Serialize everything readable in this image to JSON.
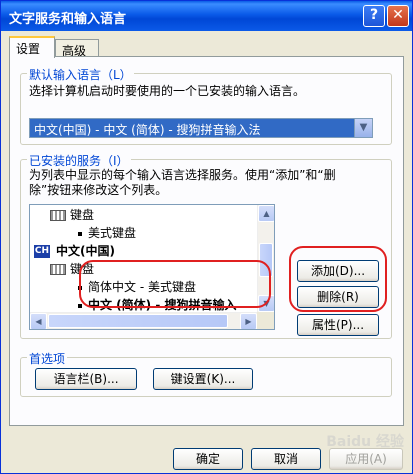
{
  "window": {
    "title": "文字服务和输入语言",
    "help_glyph": "?",
    "close_glyph": "✕"
  },
  "tabs": [
    {
      "label": "设置",
      "active": true
    },
    {
      "label": "高级",
      "active": false
    }
  ],
  "default_language": {
    "group_label": "默认输入语言（L）",
    "description": "选择计算机启动时要使用的一个已安装的输入语言。",
    "selected": "中文(中国) - 中文 (简体) - 搜狗拼音输入法"
  },
  "installed_services": {
    "group_label": "已安装的服务（I）",
    "description_line1": "为列表中显示的每个输入语言选择服务。使用“添加”和“删",
    "description_line2": "除”按钮来修改这个列表。",
    "tree": {
      "row1": "键盘",
      "row2": "美式键盘",
      "row3_icon": "CH",
      "row3": "中文(中国)",
      "row4": "键盘",
      "row5": "简体中文 - 美式键盘",
      "row6": "中文 (简体) - 搜狗拼音输入"
    },
    "buttons": {
      "add": "添加(D)...",
      "remove": "删除(R)",
      "properties": "属性(P)..."
    }
  },
  "preferences": {
    "group_label": "首选项",
    "language_bar_button": "语言栏(B)...",
    "key_settings_button": "键设置(K)..."
  },
  "footer": {
    "ok": "确定",
    "cancel": "取消",
    "apply": "应用(A)"
  },
  "watermark": "Baidu 经验"
}
